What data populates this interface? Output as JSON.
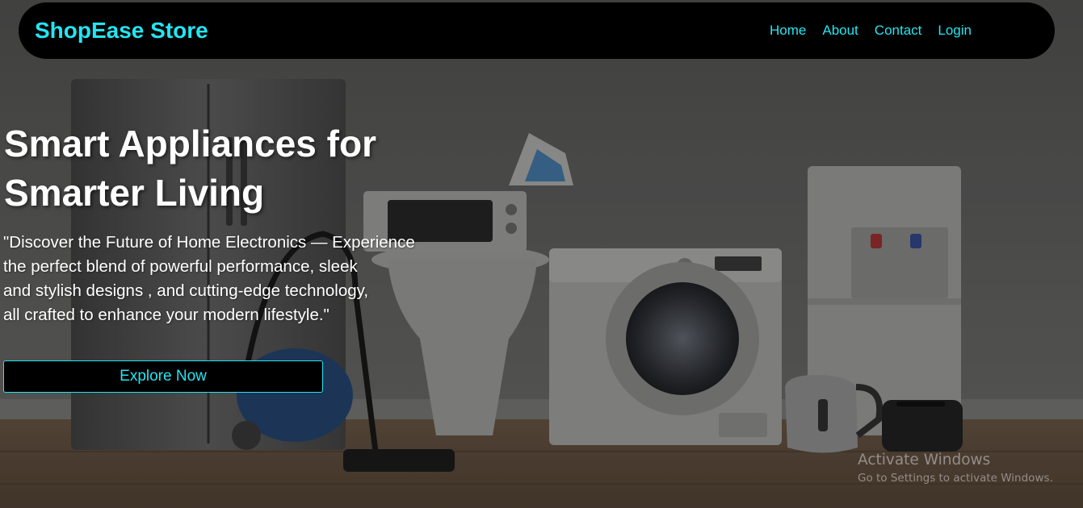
{
  "navbar": {
    "brand": "ShopEase Store",
    "links": [
      "Home",
      "About",
      "Contact",
      "Login"
    ]
  },
  "hero": {
    "title_line1": "Smart Appliances for",
    "title_line2": "Smarter Living",
    "description_lines": [
      "\"Discover the Future of Home Electronics — Experience",
      "the perfect blend of powerful performance, sleek",
      "and stylish designs , and cutting-edge technology,",
      "all crafted to enhance your modern lifestyle.\""
    ],
    "cta_label": "Explore Now"
  },
  "watermark": {
    "title": "Activate Windows",
    "subtitle": "Go to Settings to activate Windows."
  },
  "colors": {
    "accent": "#22e6f2",
    "navbar_bg": "#000000",
    "hero_text": "#ffffff"
  }
}
